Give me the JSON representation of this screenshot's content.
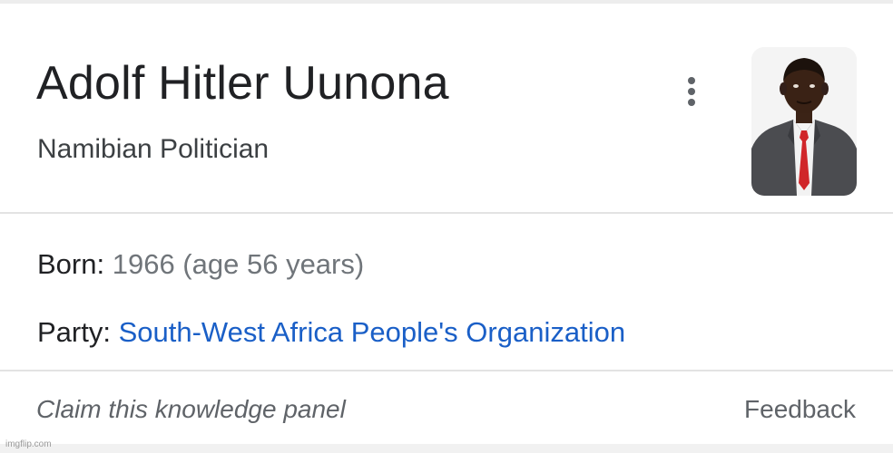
{
  "panel": {
    "title": "Adolf Hitler Uunona",
    "subtitle": "Namibian Politician",
    "menu_icon": "more-vert-icon",
    "photo_alt": "portrait-photo"
  },
  "facts": {
    "born_label": "Born:",
    "born_value": "1966 (age 56 years)",
    "party_label": "Party:",
    "party_value": "South-West Africa People's Organization"
  },
  "footer": {
    "claim": "Claim this knowledge panel",
    "feedback": "Feedback"
  },
  "watermark": "imgflip.com",
  "colors": {
    "link": "#1a5fc7",
    "title": "#202124",
    "secondary": "#70757a"
  }
}
